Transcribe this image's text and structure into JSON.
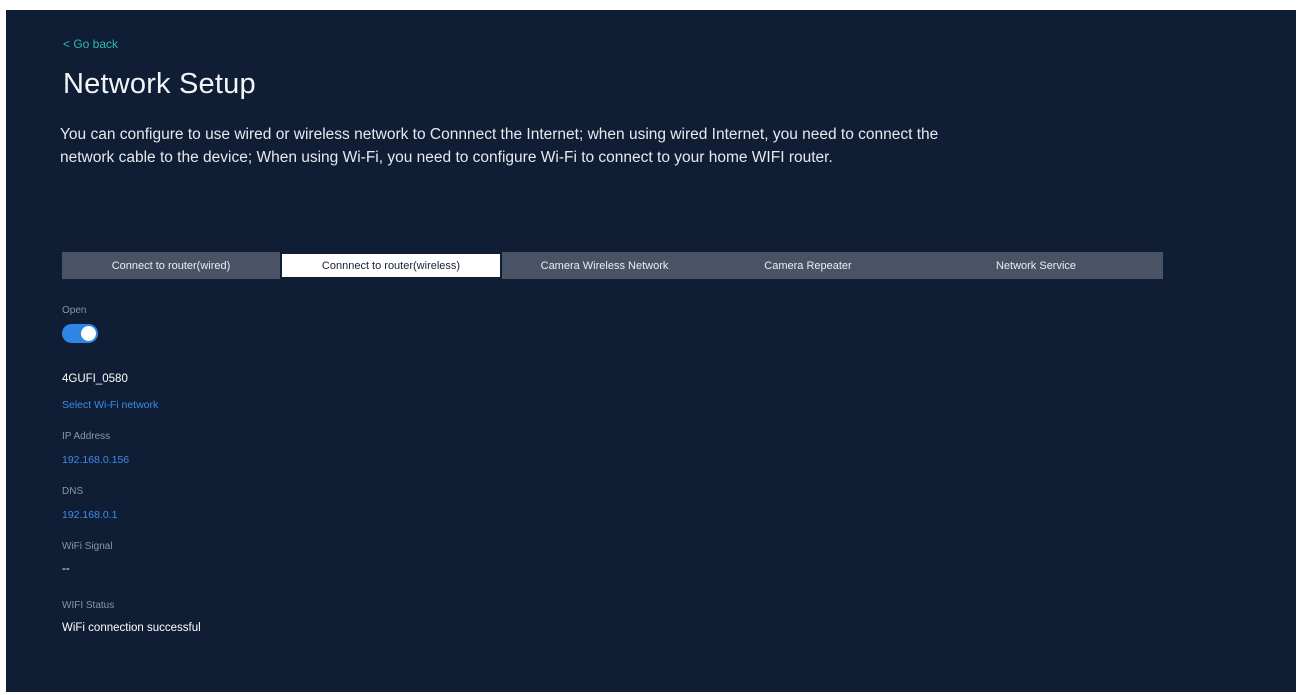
{
  "nav": {
    "back_label": "< Go back"
  },
  "header": {
    "title": "Network Setup",
    "description": "You can configure to use wired or wireless network to Connnect the Internet; when using wired Internet, you need to connect the network cable to the device; When using Wi-Fi, you need to configure Wi-Fi to connect to your home WIFI router."
  },
  "tabs": [
    {
      "label": "Connect to router(wired)",
      "active": false
    },
    {
      "label": "Connnect to router(wireless)",
      "active": true
    },
    {
      "label": "Camera Wireless Network",
      "active": false
    },
    {
      "label": "Camera Repeater",
      "active": false
    },
    {
      "label": "Network Service",
      "active": false
    }
  ],
  "wireless": {
    "open_label": "Open",
    "open_enabled": true,
    "network_name": "4GUFI_0580",
    "select_network_link": "Select Wi-Fi network",
    "ip_label": "IP Address",
    "ip_value": "192.168.0.156",
    "dns_label": "DNS",
    "dns_value": "192.168.0.1",
    "signal_label": "WiFi Signal",
    "signal_value": "--",
    "status_label": "WIFI Status",
    "status_value": "WiFi connection successful"
  },
  "colors": {
    "background": "#0f1e35",
    "accent_teal": "#2fb8b0",
    "accent_blue": "#2d86e6",
    "tab_bar": "#4a5366"
  }
}
